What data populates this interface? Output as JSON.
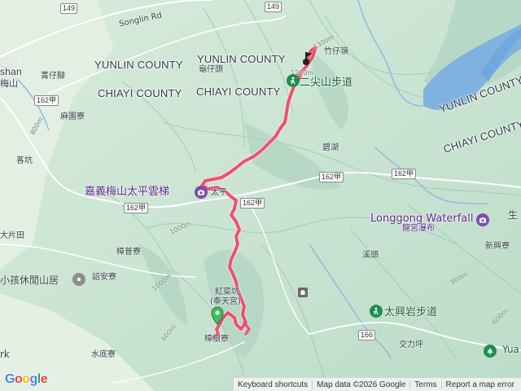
{
  "roads": {
    "r149_top": "149",
    "r149_right": "149",
    "r162_a": "162甲",
    "r162_b": "162甲",
    "r162_c": "162甲",
    "r162_d": "162甲",
    "r162_e": "162甲",
    "r166": "166",
    "songlin": "Songlin Rd"
  },
  "counties": {
    "yunlin_left": "YUNLIN COUNTY",
    "yunlin_top": "YUNLIN COUNTY",
    "chiayi_left": "CHIAYI COUNTY",
    "chiayi_top": "CHIAYI COUNTY",
    "yunlin_right": "YUNLIN COUNTY",
    "chiayi_right": "CHIAYI COUNTY"
  },
  "places": {
    "shan": "shan",
    "shan_zh": "梅山",
    "jingzijiao": "菁仔腳",
    "mayuanliao": "麻園寮",
    "guikeng": "茖坑",
    "dapianshan": "大片田",
    "guizaitou": "龜仔頭",
    "zhuzailing": "竹仔嶺",
    "bihu": "碧湖",
    "taiping": "太平",
    "zhangpuliao": "樟普寮",
    "shaoanliao": "詔安寮",
    "xitou": "溪頭",
    "hongyakeng": "紅菜坑",
    "fengtian": "(奉天宮)",
    "zhangshuliao": "樟樹寮",
    "shuidiliao": "水底寮",
    "jiaolipin": "交力坪",
    "xinxingliao": "新興寮",
    "sheng": "生",
    "yua": "Yua",
    "rk": "rk"
  },
  "pois": {
    "erjian_trail": "二尖山步道",
    "taiping_skywalk": "嘉義梅山太平雲梯",
    "longgong_en": "Longgong Waterfall",
    "longgong_zh": "龍宮瀑布",
    "cabin": "小孩休閒山居",
    "taixingyan_trail": "太興岩步道"
  },
  "elevation_ticks": [
    "1300m",
    "1200m",
    "1000m",
    "1000m",
    "800m",
    "600m",
    "800m",
    "600m"
  ],
  "track": {
    "color": "#f0506e",
    "start_marker": "green-flag",
    "end_marker": "black-flag"
  },
  "attribution": {
    "google": "Google",
    "keyboard": "Keyboard shortcuts",
    "mapdata": "Map data ©2026 Google",
    "terms": "Terms",
    "report": "Report a map error"
  },
  "colors": {
    "land": "#cfe6d2",
    "ridge": "#9cc8b2",
    "water": "#6fa8dc",
    "track": "#f0506e",
    "poi_purple": "#7b4fb0",
    "poi_green": "#1f8f4e"
  }
}
